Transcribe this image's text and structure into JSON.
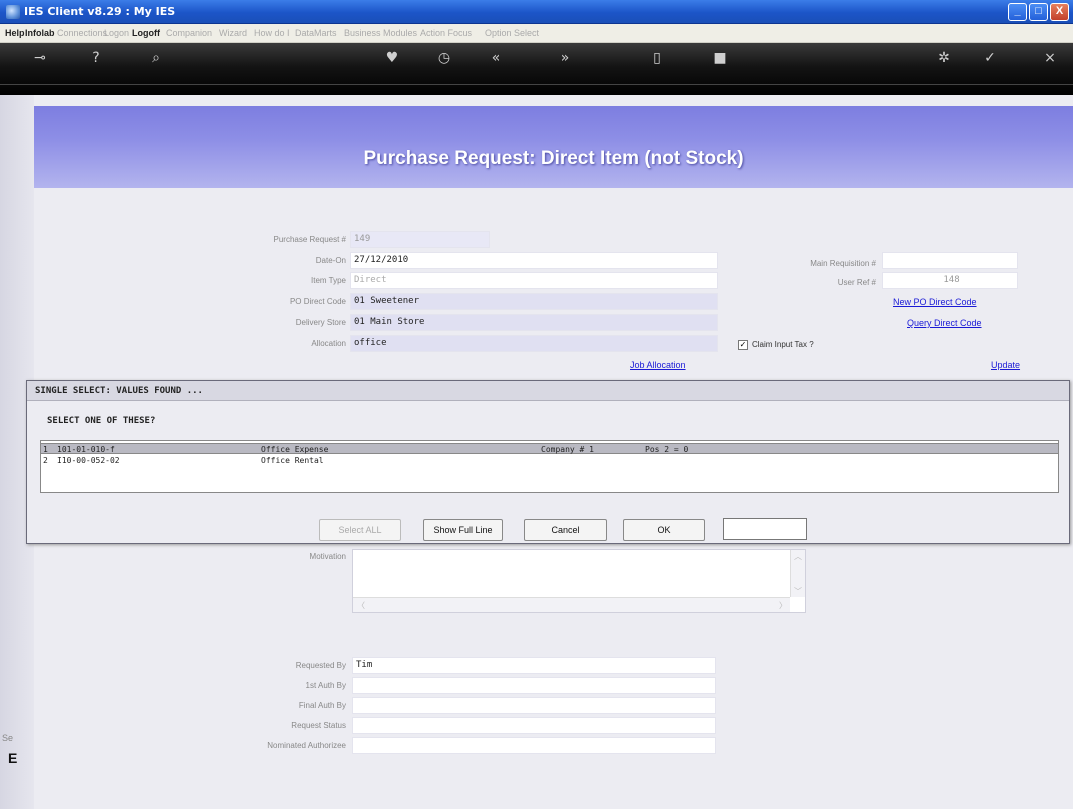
{
  "window": {
    "title": "IES Client v8.29 : My IES",
    "min": "_",
    "max": "□",
    "close": "X"
  },
  "menu": [
    "Help",
    "Infolab",
    "Connections",
    "Logon",
    "Logoff",
    "Companion",
    "Wizard",
    "How do I",
    "DataMarts",
    "Business Modules",
    "Action Focus",
    "Option Select"
  ],
  "toolbar": {
    "icons": [
      "key-icon",
      "help-icon",
      "search-icon",
      "heart-icon",
      "clock-icon",
      "back-icon",
      "forward-icon",
      "stop-icon",
      "home-icon",
      "globe-icon",
      "check-icon",
      "close-icon"
    ]
  },
  "page": {
    "title": "Purchase Request: Direct Item (not Stock)"
  },
  "form": {
    "purchase_request_label": "Purchase Request #",
    "purchase_request_value": "149",
    "date_label": "Date-On",
    "date_value": "27/12/2010",
    "item_type_label": "Item Type",
    "item_type_value": "Direct",
    "po_direct_code_label": "PO Direct Code",
    "po_direct_code_value": "01 Sweetener",
    "delivery_store_label": "Delivery Store",
    "delivery_store_value": "01 Main Store",
    "allocation_label": "Allocation",
    "allocation_value": "office",
    "main_requisition_label": "Main Requisition #",
    "main_requisition_value": "",
    "user_ref_label": "User Ref #",
    "user_ref_value": "148",
    "new_po_direct_code": "New PO Direct Code",
    "query_direct_code": "Query Direct Code",
    "claim_input_tax_label": "Claim Input Tax ?",
    "claim_input_tax_mark": "✓",
    "job_allocation": "Job Allocation",
    "update": "Update"
  },
  "dialog": {
    "title": "SINGLE SELECT: VALUES FOUND ...",
    "prompt": "SELECT ONE OF THESE?",
    "rows": [
      {
        "num": "1",
        "code": "101-01-010-f",
        "desc": "Office Expense",
        "company": "Company # 1",
        "pos": "Pos 2 = 0"
      },
      {
        "num": "2",
        "code": "I10-00-052-02",
        "desc": "Office Rental",
        "company": "",
        "pos": ""
      }
    ],
    "buttons": {
      "select_all": "Select ALL",
      "show_full_line": "Show Full Line",
      "cancel": "Cancel",
      "ok": "OK"
    },
    "input_value": ""
  },
  "lower": {
    "motivation_label": "Motivation",
    "requested_by_label": "Requested By",
    "requested_by_value": "Tim",
    "first_auth_label": "1st Auth By",
    "final_auth_label": "Final Auth By",
    "request_status_label": "Request Status",
    "nominated_authorizee_label": "Nominated Authorizee"
  },
  "side": {
    "label": "Se",
    "glyph": "E"
  }
}
